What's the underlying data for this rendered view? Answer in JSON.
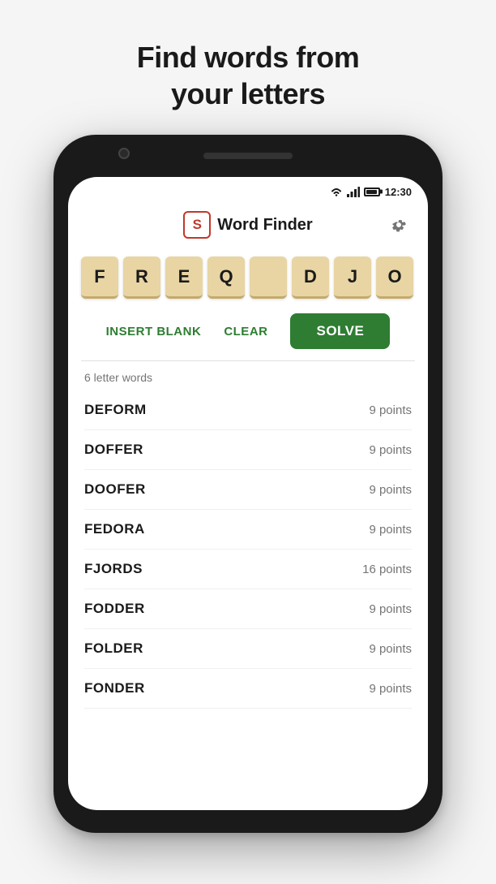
{
  "headline": {
    "line1": "Find words from",
    "line2": "your letters"
  },
  "status_bar": {
    "time": "12:30"
  },
  "app": {
    "logo_letter": "S",
    "title": "Word Finder"
  },
  "tiles": [
    {
      "letter": "F",
      "blank": false
    },
    {
      "letter": "R",
      "blank": false
    },
    {
      "letter": "E",
      "blank": false
    },
    {
      "letter": "Q",
      "blank": false
    },
    {
      "letter": "",
      "blank": true
    },
    {
      "letter": "D",
      "blank": false
    },
    {
      "letter": "J",
      "blank": false
    },
    {
      "letter": "O",
      "blank": false
    }
  ],
  "buttons": {
    "insert_blank": "INSERT BLANK",
    "clear": "CLEAR",
    "solve": "SOLVE"
  },
  "words_section": {
    "label": "6 letter words",
    "words": [
      {
        "word": "DEFORM",
        "points": "9 points"
      },
      {
        "word": "DOFFER",
        "points": "9 points"
      },
      {
        "word": "DOOFER",
        "points": "9 points"
      },
      {
        "word": "FEDORA",
        "points": "9 points"
      },
      {
        "word": "FJORDS",
        "points": "16 points"
      },
      {
        "word": "FODDER",
        "points": "9 points"
      },
      {
        "word": "FOLDER",
        "points": "9 points"
      },
      {
        "word": "FONDER",
        "points": "9 points"
      }
    ]
  },
  "icons": {
    "gear": "⚙",
    "wifi": "▲",
    "signal": "▲",
    "battery": ""
  }
}
